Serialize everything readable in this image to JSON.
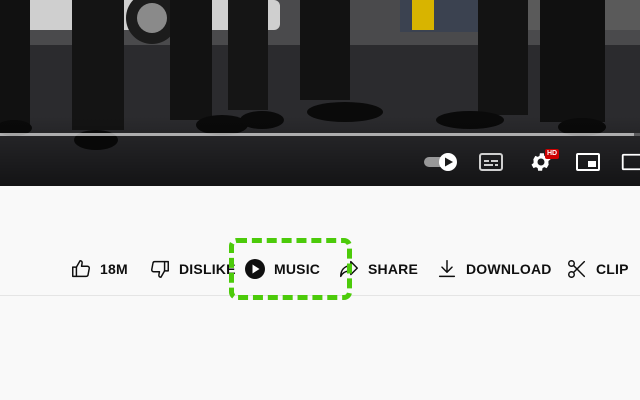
{
  "player": {
    "progress_fraction": 0.99,
    "hd_badge": "HD",
    "controls": [
      {
        "name": "autoplay-toggle",
        "icon": "toggle-play-icon"
      },
      {
        "name": "subtitles-button",
        "icon": "subtitles-icon"
      },
      {
        "name": "settings-button",
        "icon": "gear-icon"
      },
      {
        "name": "miniplayer-button",
        "icon": "miniplayer-icon"
      },
      {
        "name": "theater-button",
        "icon": "theater-icon"
      }
    ]
  },
  "actions": {
    "like": {
      "label": "18M",
      "icon": "thumbs-up-icon"
    },
    "dislike": {
      "label": "DISLIKE",
      "icon": "thumbs-down-icon"
    },
    "music": {
      "label": "MUSIC",
      "icon": "play-circle-icon"
    },
    "share": {
      "label": "SHARE",
      "icon": "share-arrow-icon"
    },
    "download": {
      "label": "DOWNLOAD",
      "icon": "download-icon"
    },
    "clip": {
      "label": "CLIP",
      "icon": "scissors-icon"
    }
  },
  "colors": {
    "highlight": "#4ccb0a",
    "hd_badge": "#cc0000",
    "text": "#0f0f0f",
    "background": "#f9f9f9"
  }
}
